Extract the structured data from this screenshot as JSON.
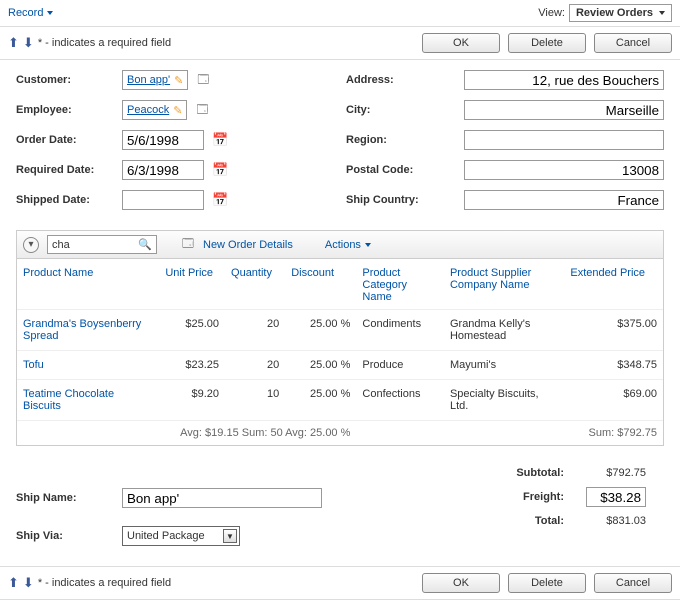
{
  "topbar": {
    "record_label": "Record",
    "view_label": "View:",
    "view_value": "Review Orders"
  },
  "hintbar": {
    "hint": "* - indicates a required field",
    "ok": "OK",
    "delete": "Delete",
    "cancel": "Cancel"
  },
  "form_left": {
    "customer_label": "Customer:",
    "customer_value": "Bon app'",
    "employee_label": "Employee:",
    "employee_value": "Peacock",
    "order_date_label": "Order Date:",
    "order_date_value": "5/6/1998",
    "required_date_label": "Required Date:",
    "required_date_value": "6/3/1998",
    "shipped_date_label": "Shipped Date:",
    "shipped_date_value": ""
  },
  "form_right": {
    "address_label": "Address:",
    "address_value": "12, rue des Bouchers",
    "city_label": "City:",
    "city_value": "Marseille",
    "region_label": "Region:",
    "region_value": "",
    "postal_label": "Postal Code:",
    "postal_value": "13008",
    "country_label": "Ship Country:",
    "country_value": "France"
  },
  "grid_toolbar": {
    "search_value": "cha",
    "new_label": "New Order Details",
    "actions_label": "Actions"
  },
  "grid_headers": {
    "product": "Product Name",
    "unit_price": "Unit Price",
    "quantity": "Quantity",
    "discount": "Discount",
    "category": "Product Category Name",
    "supplier": "Product Supplier Company Name",
    "extended": "Extended Price"
  },
  "grid_rows": [
    {
      "product": "Grandma's Boysenberry Spread",
      "unit_price": "$25.00",
      "quantity": "20",
      "discount": "25.00 %",
      "category": "Condiments",
      "supplier": "Grandma Kelly's Homestead",
      "extended": "$375.00"
    },
    {
      "product": "Tofu",
      "unit_price": "$23.25",
      "quantity": "20",
      "discount": "25.00 %",
      "category": "Produce",
      "supplier": "Mayumi's",
      "extended": "$348.75"
    },
    {
      "product": "Teatime Chocolate Biscuits",
      "unit_price": "$9.20",
      "quantity": "10",
      "discount": "25.00 %",
      "category": "Confections",
      "supplier": "Specialty Biscuits, Ltd.",
      "extended": "$69.00"
    }
  ],
  "grid_summary": {
    "left": "Avg: $19.15  Sum: 50  Avg: 25.00 %",
    "right": "Sum: $792.75"
  },
  "totals": {
    "subtotal_label": "Subtotal:",
    "subtotal_value": "$792.75",
    "freight_label": "Freight:",
    "freight_value": "$38.28",
    "total_label": "Total:",
    "total_value": "$831.03"
  },
  "ship": {
    "name_label": "Ship Name:",
    "name_value": "Bon app'",
    "via_label": "Ship Via:",
    "via_value": "United Package"
  },
  "chart_data": {
    "type": "table",
    "title": "Order Details",
    "columns": [
      "Product Name",
      "Unit Price",
      "Quantity",
      "Discount",
      "Product Category Name",
      "Product Supplier Company Name",
      "Extended Price"
    ],
    "rows": [
      [
        "Grandma's Boysenberry Spread",
        25.0,
        20,
        0.25,
        "Condiments",
        "Grandma Kelly's Homestead",
        375.0
      ],
      [
        "Tofu",
        23.25,
        20,
        0.25,
        "Produce",
        "Mayumi's",
        348.75
      ],
      [
        "Teatime Chocolate Biscuits",
        9.2,
        10,
        0.25,
        "Confections",
        "Specialty Biscuits, Ltd.",
        69.0
      ]
    ],
    "aggregates": {
      "unit_price_avg": 19.15,
      "quantity_sum": 50,
      "discount_avg": 0.25,
      "extended_sum": 792.75
    }
  }
}
